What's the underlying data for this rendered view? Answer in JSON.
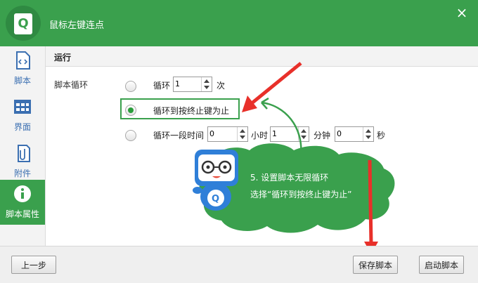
{
  "window": {
    "title": "鼠标左键连点",
    "close_icon": "×"
  },
  "sidebar": {
    "items": [
      {
        "label": "脚本",
        "icon": "code-file-icon"
      },
      {
        "label": "界面",
        "icon": "grid-icon"
      },
      {
        "label": "附件",
        "icon": "attachment-icon"
      },
      {
        "label": "脚本属性",
        "icon": "info-icon",
        "active": true
      }
    ]
  },
  "content": {
    "section_title": "运行",
    "loop_label": "脚本循环",
    "options": {
      "loop": {
        "text": "循环",
        "value": "1",
        "unit": "次"
      },
      "until_stop": {
        "text": "循环到按终止键为止",
        "checked": true
      },
      "duration": {
        "text": "循环一段时间",
        "hours": "0",
        "hours_unit": "小时",
        "minutes": "1",
        "minutes_unit": "分钟",
        "seconds": "0",
        "seconds_unit": "秒"
      }
    }
  },
  "tip": {
    "line1": "5. 设置脚本无限循环",
    "line2": "选择“循环到按终止键为止”"
  },
  "footer": {
    "prev_label": "上一步",
    "save_label": "保存脚本",
    "start_label": "启动脚本"
  },
  "colors": {
    "accent_green": "#3aa04d",
    "arrow_red": "#e8302a"
  }
}
